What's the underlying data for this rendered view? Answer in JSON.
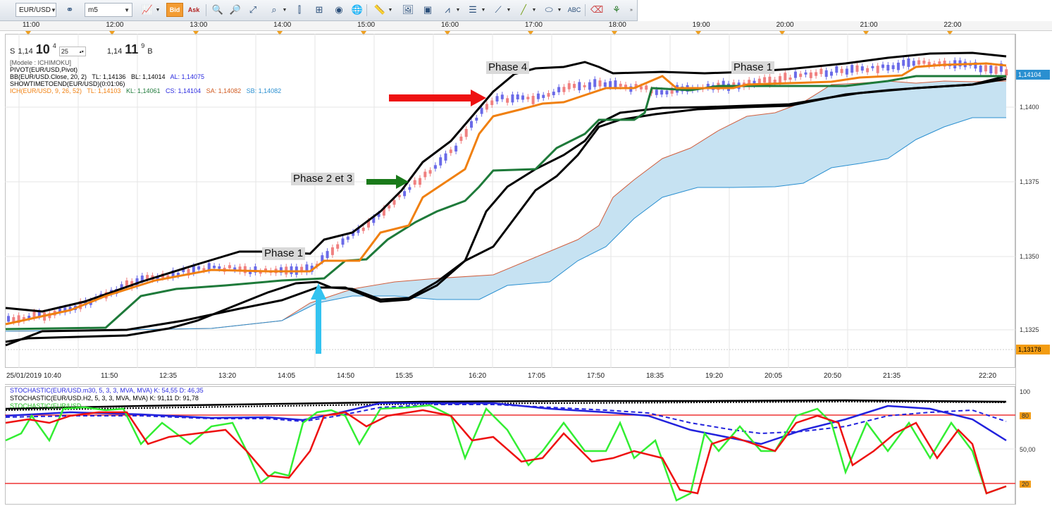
{
  "toolbar": {
    "symbol": "EUR/USD",
    "timeframe": "m5",
    "bid_label": "Bid",
    "ask_label": "Ask",
    "icons": [
      "link-icon",
      "line-chart-icon",
      "zoom-in-icon",
      "zoom-out-icon",
      "zoom-fit-icon",
      "vertical-line-icon",
      "crosshair-icon",
      "eye-icon",
      "globe-icon",
      "ruler-icon",
      "screenshot-icon",
      "window-icon",
      "indicators-icon",
      "lines-icon",
      "trend-icon",
      "pen-icon",
      "ellipse-icon",
      "text-icon",
      "eraser-icon",
      "tree-icon"
    ]
  },
  "top_time_labels": [
    "11:00",
    "12:00",
    "13:00",
    "14:00",
    "15:00",
    "16:00",
    "17:00",
    "18:00",
    "19:00",
    "20:00",
    "21:00",
    "22:00"
  ],
  "quote": {
    "s_label": "S",
    "bid_prefix": "1,14",
    "bid_big": "10",
    "bid_sup": "4",
    "spread": "25",
    "ask_prefix": "1,14",
    "ask_big": "11",
    "ask_sup": "9",
    "b_label": "B"
  },
  "indicators": {
    "model": "[Modele : ICHIMOKU]",
    "pivot": "PIVOT(EUR/USD,Pivot)",
    "bb_name": "BB(EUR/USD.Close, 20, 2)",
    "bb_tl": "TL: 1,14136",
    "bb_bl": "BL: 1,14014",
    "bb_al": "AL: 1,14075",
    "showtime": "SHOWTIMETOEND(EUR/USD)(0:01:06)",
    "ich_name": "ICH(EUR/USD, 9, 26, 52)",
    "ich_tl": "TL: 1,14103",
    "ich_kl": "KL: 1,14061",
    "ich_cs": "CS: 1,14104",
    "ich_sa": "SA: 1,14082",
    "ich_sb": "SB: 1,14082"
  },
  "annotations": {
    "phase1_left": "Phase 1",
    "phase23": "Phase 2 et 3",
    "phase4": "Phase 4",
    "phase1_right": "Phase 1"
  },
  "price_axis": {
    "labels": [
      "1,1400",
      "1,1375",
      "1,1350",
      "1,1325"
    ],
    "current_badge": "1,14104",
    "low_badge": "1,13178"
  },
  "date_axis": [
    "25/01/2019 10:40",
    "11:50",
    "12:35",
    "13:20",
    "14:05",
    "14:50",
    "15:35",
    "16:20",
    "17:05",
    "17:50",
    "18:35",
    "19:20",
    "20:05",
    "20:50",
    "21:35",
    "22:20"
  ],
  "stochastic": {
    "line1": "STOCHASTIC(EUR/USD.m30, 5, 3, 3, MVA, MVA)  K: 54,55  D: 46,35",
    "line2": "STOCHASTIC(EUR/USD.H2, 5, 3, 3, MVA, MVA)  K: 91,11  D: 91,78",
    "line3": "STOCHASTIC(EUR/USD...",
    "axis_labels": [
      "100",
      "80",
      "50,00",
      "20"
    ]
  },
  "colors": {
    "bollinger": "#000000",
    "tenkan": "#f08010",
    "kijun": "#1e7a3a",
    "chikou": "#000000",
    "kumo": "#c6e2f2",
    "bull_candle": "#6a6ae8",
    "bear_candle": "#f08080",
    "red_arrow": "#ee1111",
    "green_arrow": "#1a7a1a",
    "cyan_arrow": "#33c3f0",
    "current_badge": "#2a8fd0",
    "low_badge": "#f39c12"
  }
}
